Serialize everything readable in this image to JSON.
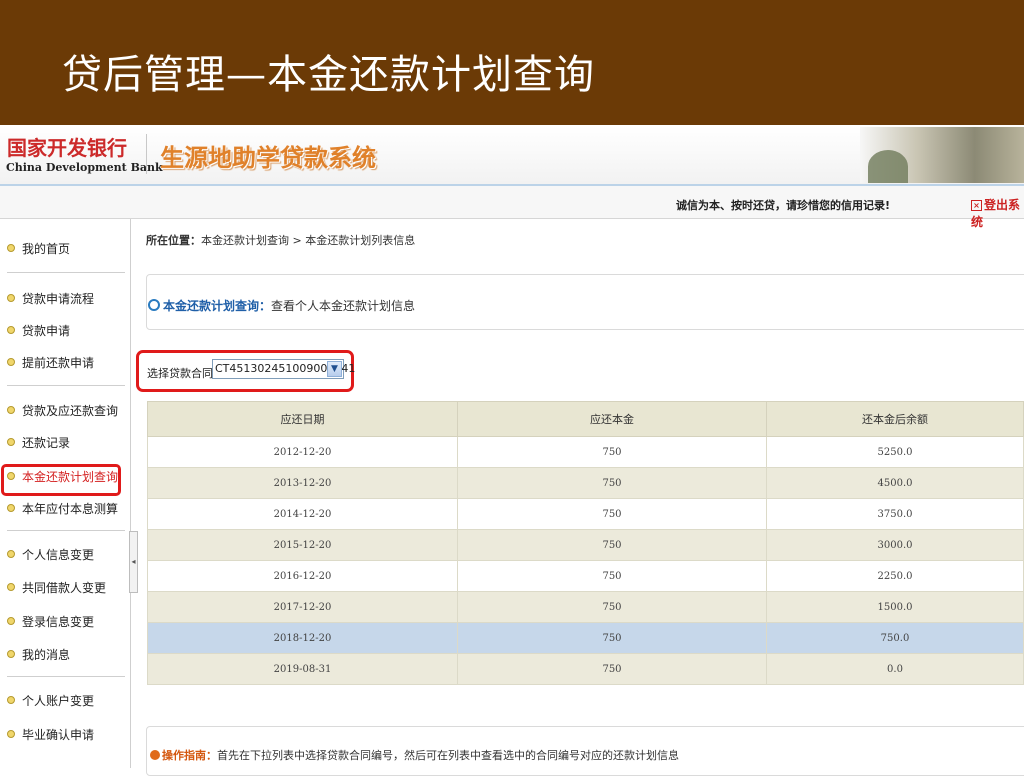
{
  "slide": {
    "title": "贷后管理—本金还款计划查询"
  },
  "app": {
    "logo_cn": "国家开发银行",
    "logo_en": "China Development Bank",
    "system_title": "生源地助学贷款系统",
    "notice": "诚信为本、按时还贷，请珍惜您的信用记录!",
    "logout_label": "登出系统"
  },
  "sidebar": {
    "items": [
      {
        "label": "我的首页"
      },
      {
        "label": "贷款申请流程"
      },
      {
        "label": "贷款申请"
      },
      {
        "label": "提前还款申请"
      },
      {
        "label": "贷款及应还款查询"
      },
      {
        "label": "还款记录"
      },
      {
        "label": "本金还款计划查询",
        "active": true
      },
      {
        "label": "本年应付本息测算"
      },
      {
        "label": "个人信息变更"
      },
      {
        "label": "共同借款人变更"
      },
      {
        "label": "登录信息变更"
      },
      {
        "label": "我的消息"
      },
      {
        "label": "个人账户变更"
      },
      {
        "label": "毕业确认申请"
      }
    ],
    "collapse_icon": "◂"
  },
  "breadcrumb": {
    "label": "所在位置：",
    "path": "本金还款计划查询 > 本金还款计划列表信息"
  },
  "query": {
    "title": "本金还款计划查询：",
    "description": "查看个人本金还款计划信息"
  },
  "contract": {
    "label": "选择贷款合同:",
    "value": "CT451302451009000741"
  },
  "table": {
    "headers": [
      "应还日期",
      "应还本金",
      "还本金后余额"
    ],
    "rows": [
      [
        "2012-12-20",
        "750",
        "5250.0"
      ],
      [
        "2013-12-20",
        "750",
        "4500.0"
      ],
      [
        "2014-12-20",
        "750",
        "3750.0"
      ],
      [
        "2015-12-20",
        "750",
        "3000.0"
      ],
      [
        "2016-12-20",
        "750",
        "2250.0"
      ],
      [
        "2017-12-20",
        "750",
        "1500.0"
      ],
      [
        "2018-12-20",
        "750",
        "750.0"
      ],
      [
        "2019-08-31",
        "750",
        "0.0"
      ]
    ],
    "selected_row": 6
  },
  "guide": {
    "title": "操作指南：",
    "text": "首先在下拉列表中选择贷款合同编号，然后可在列表中查看选中的合同编号对应的还款计划信息"
  },
  "colors": {
    "slide_header": "#6b3a06",
    "highlight_red": "#e01a1a",
    "table_header": "#e8e6d2",
    "selected_row": "#c6d7ea"
  }
}
